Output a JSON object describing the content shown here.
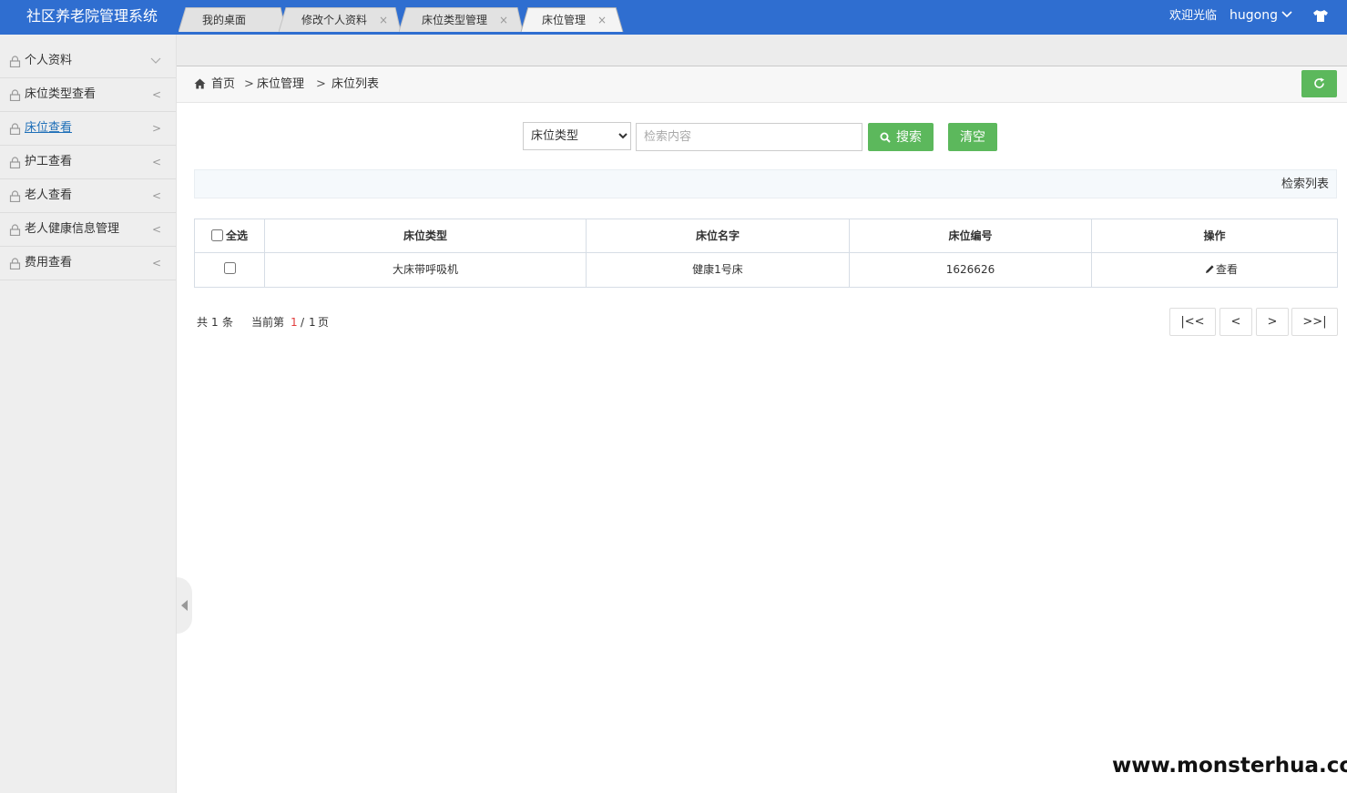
{
  "header": {
    "app_title": "社区养老院管理系统",
    "welcome": "欢迎光临",
    "username": "hugong"
  },
  "sidebar": {
    "items": [
      {
        "label": "个人资料",
        "arrow": "down"
      },
      {
        "label": "床位类型查看",
        "arrow": "<"
      },
      {
        "label": "床位查看",
        "arrow": ">",
        "active": true
      },
      {
        "label": "护工查看",
        "arrow": "<"
      },
      {
        "label": "老人查看",
        "arrow": "<"
      },
      {
        "label": "老人健康信息管理",
        "arrow": "<"
      },
      {
        "label": "费用查看",
        "arrow": "<"
      }
    ]
  },
  "tabs": [
    {
      "label": "我的桌面",
      "closable": false
    },
    {
      "label": "修改个人资料",
      "closable": true
    },
    {
      "label": "床位类型管理",
      "closable": true
    },
    {
      "label": "床位管理",
      "closable": true,
      "active": true
    }
  ],
  "breadcrumb": {
    "home": "首页",
    "level1": "床位管理",
    "level2": "床位列表",
    "separator": ">"
  },
  "search": {
    "select_value": "床位类型",
    "select_options": [
      "床位类型"
    ],
    "placeholder": "检索内容",
    "search_label": "搜索",
    "clear_label": "清空"
  },
  "list": {
    "title": "检索列表"
  },
  "table": {
    "select_all_label": "全选",
    "columns": [
      "床位类型",
      "床位名字",
      "床位编号",
      "操作"
    ],
    "rows": [
      {
        "bed_type": "大床带呼吸机",
        "bed_name": "健康1号床",
        "bed_no": "1626626",
        "action": "查看"
      }
    ]
  },
  "pagination": {
    "total_prefix": "共",
    "total": "1",
    "total_suffix": "条",
    "current_prefix": "当前第",
    "current": "1",
    "pages_sep": "/",
    "pages": "1",
    "pages_suffix": "页",
    "first": "|<<",
    "prev": "<",
    "next": ">",
    "last": ">>|"
  },
  "watermark": "www.monsterhua.com",
  "colors": {
    "header_bg": "#2f6ed0",
    "button_green": "#5cb85c",
    "active_link": "#1e6fb8",
    "current_page": "#e23c3c"
  },
  "icons": [
    "chevron-down-icon",
    "shirt-icon",
    "lock-icon",
    "home-icon",
    "refresh-icon",
    "search-icon",
    "edit-icon",
    "collapse-arrow-icon"
  ]
}
